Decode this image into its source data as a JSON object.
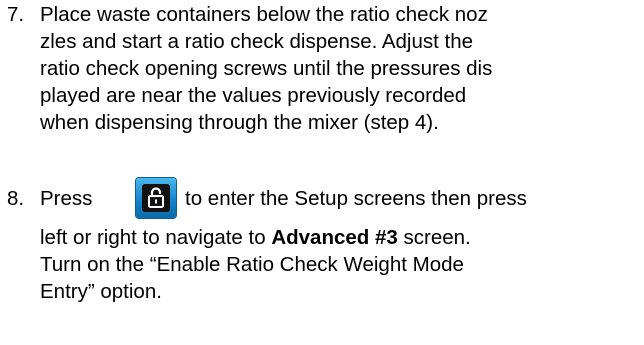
{
  "steps": [
    {
      "number": "7.",
      "lines": [
        "Place waste containers below the ratio check noz",
        "zles and start a ratio check dispense. Adjust the",
        "ratio check opening screws until the pressures dis",
        "played are near the values previously recorded",
        "when dispensing through the mixer (step 4)."
      ]
    },
    {
      "number": "8.",
      "line1_before": "Press",
      "line1_after": "to enter the Setup screens then press",
      "line2_before": "left or right to navigate to ",
      "line2_bold": "Advanced #3",
      "line2_after": " screen.",
      "line3": "Turn on the “Enable Ratio Check Weight Mode",
      "line4": "Entry” option."
    }
  ],
  "icons": {
    "unlock_button": "unlock-padlock-icon",
    "button_color": "#1485cc"
  }
}
